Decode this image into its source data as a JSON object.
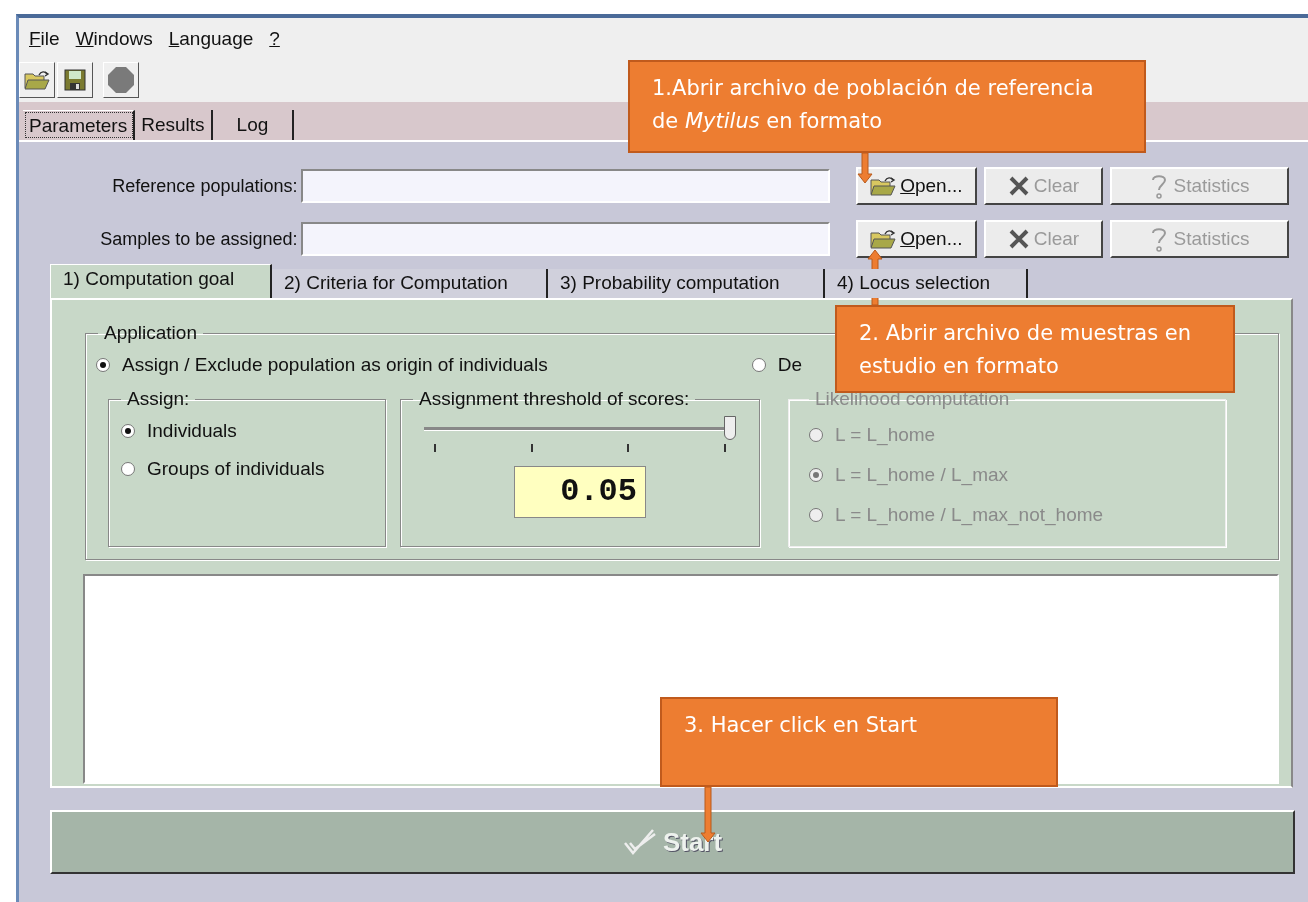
{
  "menu": [
    {
      "label": "File"
    },
    {
      "label": "Windows"
    },
    {
      "label": "Language"
    },
    {
      "label": "?"
    }
  ],
  "main_tabs": [
    {
      "label": "Parameters",
      "selected": true
    },
    {
      "label": "Results",
      "selected": false
    },
    {
      "label": "Log",
      "selected": false
    }
  ],
  "file_rows": [
    {
      "label": "Reference populations:",
      "buttons": [
        {
          "kind": "open",
          "label": "Open...",
          "disabled": false
        },
        {
          "kind": "clear",
          "label": "Clear",
          "disabled": true
        },
        {
          "kind": "stats",
          "label": "Statistics",
          "disabled": true
        }
      ]
    },
    {
      "label": "Samples to be assigned:",
      "buttons": [
        {
          "kind": "open",
          "label": "Open...",
          "disabled": false
        },
        {
          "kind": "clear",
          "label": "Clear",
          "disabled": true
        },
        {
          "kind": "stats",
          "label": "Statistics",
          "disabled": true
        }
      ]
    }
  ],
  "sub_tabs": [
    {
      "label": "1) Computation goal",
      "selected": true
    },
    {
      "label": "2) Criteria for Computation",
      "selected": false
    },
    {
      "label": "3) Probability computation",
      "selected": false
    },
    {
      "label": "4) Locus selection",
      "selected": false
    }
  ],
  "application": {
    "title": "Application",
    "options": [
      {
        "label": "Assign / Exclude population as origin of individuals",
        "selected": true
      },
      {
        "label": "De",
        "selected": false
      }
    ]
  },
  "assign": {
    "title": "Assign:",
    "options": [
      {
        "label": "Individuals",
        "selected": true
      },
      {
        "label": "Groups of individuals",
        "selected": false
      }
    ]
  },
  "threshold": {
    "title": "Assignment threshold of scores:",
    "level": 1,
    "value": "0.05"
  },
  "likelihood": {
    "title": "Likelihood computation",
    "disabled": true,
    "options": [
      {
        "label": "L = L_home",
        "selected": false
      },
      {
        "label": "L = L_home / L_max",
        "selected": true
      },
      {
        "label": "L = L_home / L_max_not_home",
        "selected": false
      }
    ]
  },
  "start_button": {
    "label": "Start",
    "disabled": true
  },
  "annotations": [
    {
      "text": "1.Abrir archivo de población de referencia de *Mytilus* en formato"
    },
    {
      "text": "2. Abrir archivo de muestras en estudio en formato"
    },
    {
      "text": "3. Hacer click en Start"
    }
  ]
}
